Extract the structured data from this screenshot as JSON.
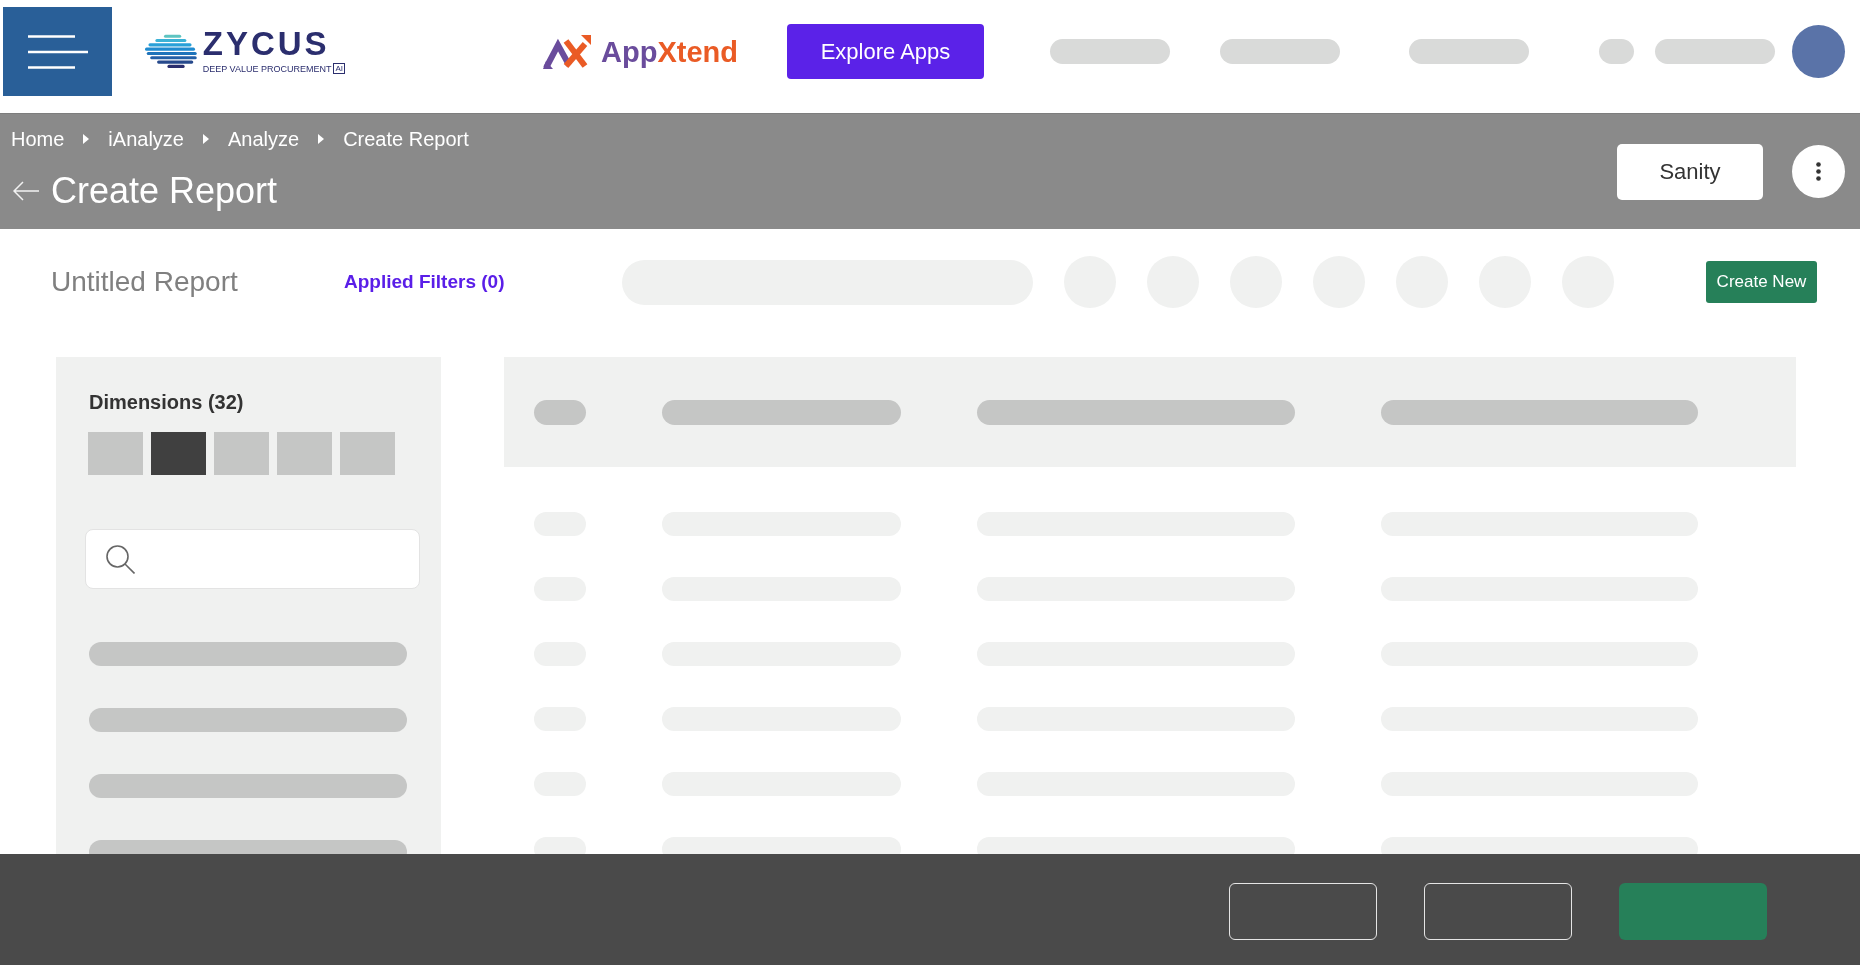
{
  "top_bar": {
    "brand": {
      "name": "ZYCUS",
      "tagline": "DEEP VALUE PROCUREMENT",
      "tag": "AI"
    },
    "app_logo": {
      "wordmark": [
        "App",
        "Xtend"
      ]
    },
    "explore_button": "Explore Apps",
    "nav_items": [
      {
        "kind": "skeleton"
      },
      {
        "kind": "skeleton"
      },
      {
        "kind": "skeleton"
      },
      {
        "kind": "skeleton"
      },
      {
        "kind": "skeleton"
      }
    ]
  },
  "header": {
    "breadcrumbs": [
      "Home",
      "iAnalyze",
      "Analyze",
      "Create Report"
    ],
    "title": "Create Report",
    "view_button": "Sanity"
  },
  "toolbar": {
    "report_name": "Untitled Report",
    "filters_link": "Applied Filters (0)",
    "controls": [
      {
        "kind": "search-skeleton"
      },
      {
        "kind": "circle-skeleton"
      },
      {
        "kind": "circle-skeleton"
      },
      {
        "kind": "circle-skeleton"
      },
      {
        "kind": "circle-skeleton"
      },
      {
        "kind": "circle-skeleton"
      },
      {
        "kind": "circle-skeleton"
      },
      {
        "kind": "circle-skeleton"
      }
    ],
    "create_button": "Create New"
  },
  "dimensions_panel": {
    "title": "Dimensions (32)",
    "tabs": [
      {
        "selected": false
      },
      {
        "selected": true
      },
      {
        "selected": false
      },
      {
        "selected": false
      },
      {
        "selected": false
      }
    ],
    "items": [
      {
        "kind": "skeleton"
      },
      {
        "kind": "skeleton"
      },
      {
        "kind": "skeleton"
      },
      {
        "kind": "skeleton"
      }
    ]
  },
  "table": {
    "columns": [
      {
        "kind": "skeleton"
      },
      {
        "kind": "skeleton"
      },
      {
        "kind": "skeleton"
      },
      {
        "kind": "skeleton"
      }
    ],
    "rows": [
      {
        "kind": "skeleton"
      },
      {
        "kind": "skeleton"
      },
      {
        "kind": "skeleton"
      },
      {
        "kind": "skeleton"
      },
      {
        "kind": "skeleton"
      },
      {
        "kind": "skeleton"
      }
    ]
  },
  "footer": {
    "buttons": [
      {
        "kind": "outline"
      },
      {
        "kind": "outline"
      },
      {
        "kind": "primary"
      }
    ]
  }
}
